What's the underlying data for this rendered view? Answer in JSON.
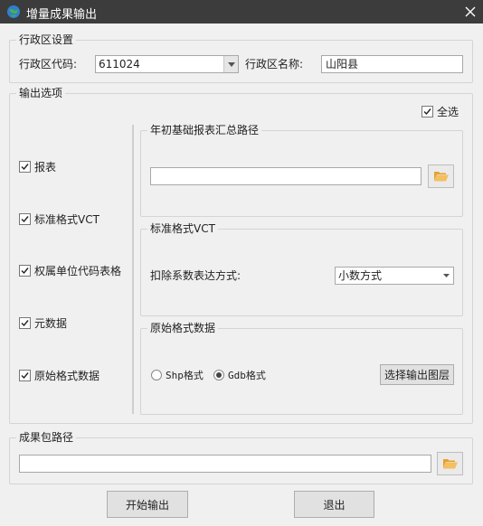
{
  "window": {
    "title": "增量成果输出",
    "close_glyph": "✕"
  },
  "region": {
    "legend": "行政区设置",
    "code_label": "行政区代码:",
    "code_value": "611024",
    "name_label": "行政区名称:",
    "name_value": "山阳县"
  },
  "output_options": {
    "legend": "输出选项",
    "select_all": {
      "label": "全选",
      "checked": true
    },
    "items": [
      {
        "label": "报表",
        "checked": true
      },
      {
        "label": "标准格式VCT",
        "checked": true
      },
      {
        "label": "权属单位代码表格",
        "checked": true
      },
      {
        "label": "元数据",
        "checked": true
      },
      {
        "label": "原始格式数据",
        "checked": true
      }
    ]
  },
  "report_path": {
    "legend": "年初基础报表汇总路径",
    "value": ""
  },
  "vct": {
    "legend": "标准格式VCT",
    "deduct_label": "扣除系数表达方式:",
    "deduct_value": "小数方式"
  },
  "raw_data": {
    "legend": "原始格式数据",
    "shp_label": "Shp格式",
    "gdb_label": "Gdb格式",
    "selected": "gdb",
    "select_layers_label": "选择输出图层"
  },
  "result_path": {
    "legend": "成果包路径",
    "value": ""
  },
  "buttons": {
    "start_label": "开始输出",
    "exit_label": "退出"
  },
  "colors": {
    "titlebar": "#3c3c3c",
    "folder_icon": "#e8a030"
  }
}
